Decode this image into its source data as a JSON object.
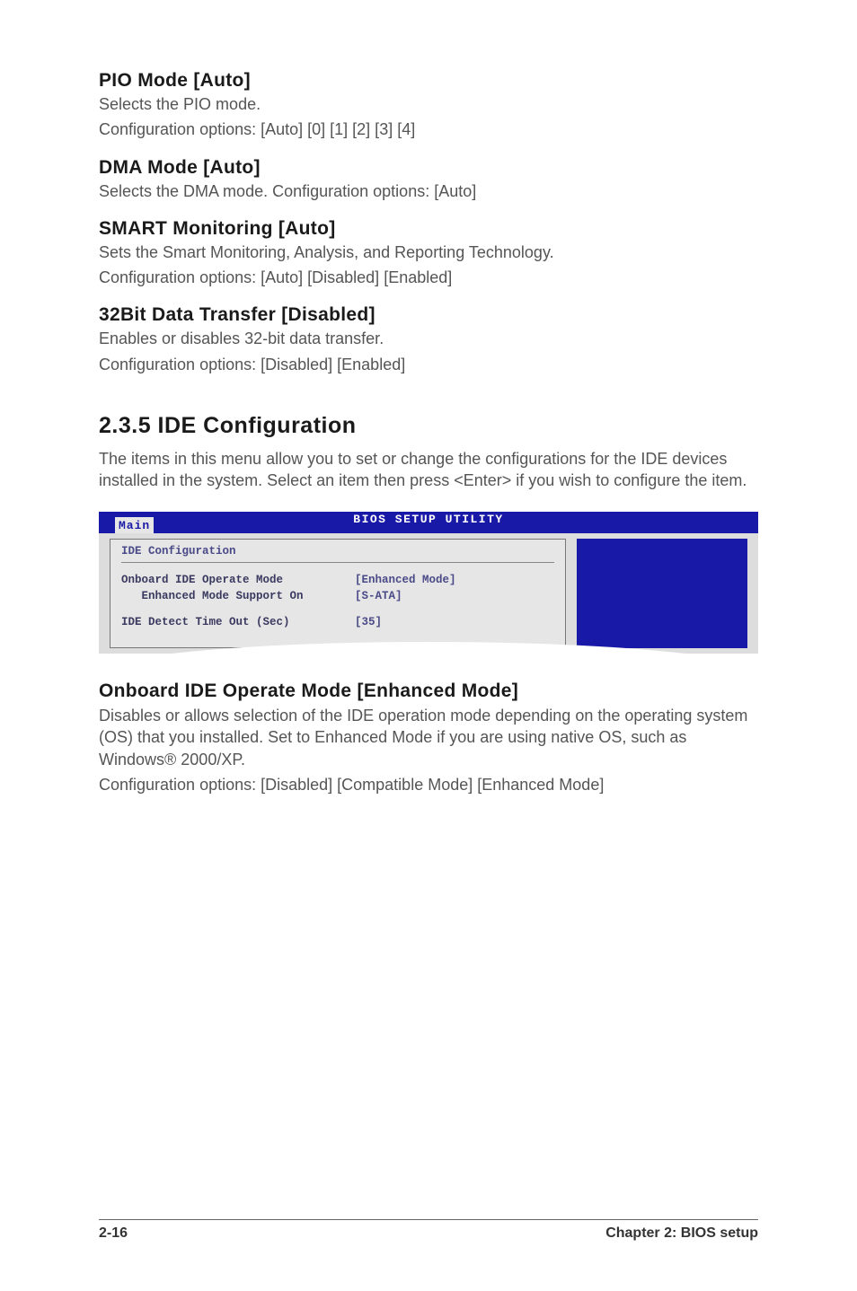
{
  "sections": {
    "pio": {
      "title": "PIO Mode [Auto]",
      "line1": "Selects the PIO mode.",
      "line2": "Configuration options: [Auto] [0] [1] [2] [3] [4]"
    },
    "dma": {
      "title": "DMA Mode [Auto]",
      "line1": "Selects the DMA mode. Configuration options: [Auto]"
    },
    "smart": {
      "title": "SMART Monitoring [Auto]",
      "line1": "Sets the Smart Monitoring, Analysis, and Reporting Technology.",
      "line2": "Configuration options: [Auto] [Disabled] [Enabled]"
    },
    "bit32": {
      "title": "32Bit Data Transfer [Disabled]",
      "line1": "Enables or disables 32-bit data transfer.",
      "line2": "Configuration options: [Disabled] [Enabled]"
    }
  },
  "main": {
    "title": "2.3.5   IDE Configuration",
    "intro": "The items in this menu allow you to set or change the configurations for the IDE devices installed in the system. Select an item then press <Enter> if you wish to configure the item."
  },
  "bios": {
    "header_text": "BIOS SETUP UTILITY",
    "tab": "Main",
    "panel_title": "IDE Configuration",
    "rows": [
      {
        "label": "Onboard IDE Operate Mode",
        "value": "[Enhanced Mode]"
      },
      {
        "label": "   Enhanced Mode Support On",
        "value": "[S-ATA]"
      }
    ],
    "rows2": [
      {
        "label": "IDE Detect Time Out (Sec)",
        "value": "[35]"
      }
    ]
  },
  "onboard": {
    "title": "Onboard IDE Operate Mode [Enhanced Mode]",
    "line1": "Disables or allows selection of the IDE operation mode depending on the operating system (OS) that you installed. Set to Enhanced Mode if you are using native OS, such as Windows® 2000/XP.",
    "line2": "Configuration options: [Disabled] [Compatible Mode] [Enhanced Mode]"
  },
  "footer": {
    "left": "2-16",
    "right": "Chapter 2: BIOS setup"
  }
}
